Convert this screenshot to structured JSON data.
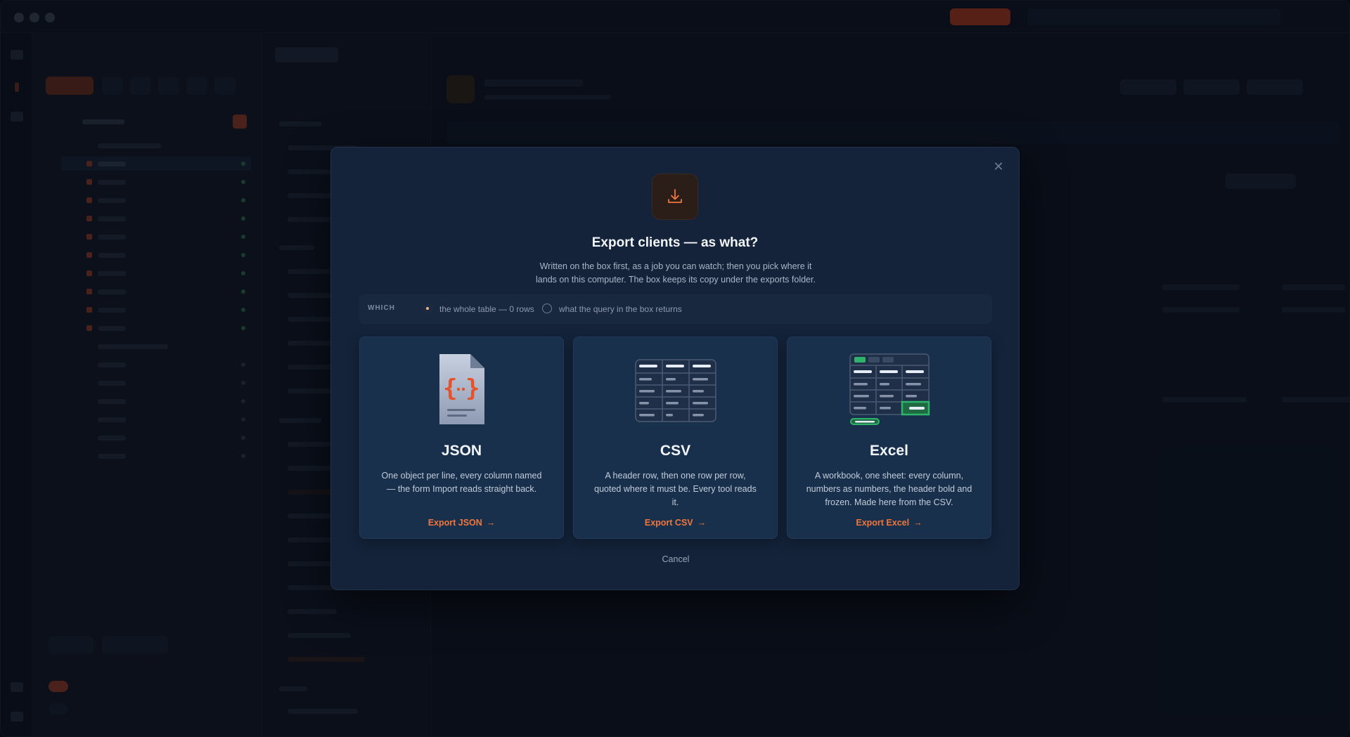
{
  "dialog": {
    "title": "Export clients — as what?",
    "subtitle": "Written on the box first, as a job you can watch; then you pick where it lands on this computer. The box keeps its copy under the exports folder.",
    "close_icon": "close-icon",
    "badge_icon": "download-icon",
    "which": {
      "label": "WHICH",
      "options": [
        {
          "label": "the whole table — 0 rows",
          "selected": true
        },
        {
          "label": "what the query in the box returns",
          "selected": false
        }
      ]
    },
    "formats": [
      {
        "icon": "json-file-icon",
        "title": "JSON",
        "description": "One object per line, every column named — the form Import reads straight back.",
        "action": "Export JSON"
      },
      {
        "icon": "csv-table-icon",
        "title": "CSV",
        "description": "A header row, then one row per row, quoted where it must be. Every tool reads it.",
        "action": "Export CSV"
      },
      {
        "icon": "excel-sheet-icon",
        "title": "Excel",
        "description": "A workbook, one sheet: every column, numbers as numbers, the header bold and frozen. Made here from the CSV.",
        "action": "Export Excel"
      }
    ],
    "cancel": "Cancel"
  },
  "colors": {
    "accent": "#f0763c",
    "dialog_bg": "#14233a",
    "card_bg": "#19304c",
    "excel_green": "#2fb36a"
  }
}
